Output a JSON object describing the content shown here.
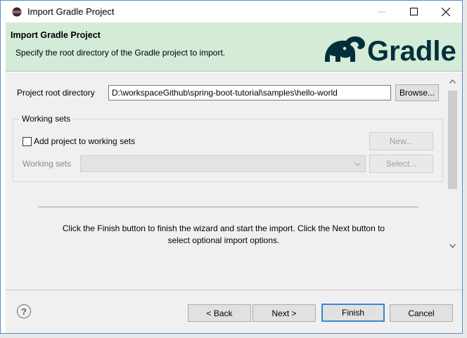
{
  "window": {
    "title": "Import Gradle Project",
    "minimize_icon": "minimize-icon",
    "maximize_icon": "maximize-icon",
    "close_icon": "close-icon"
  },
  "banner": {
    "title": "Import Gradle Project",
    "description": "Specify the root directory of the Gradle project to import.",
    "logo_text": "Gradle",
    "logo_color": "#02303a",
    "background_color": "#d4ebd8"
  },
  "form": {
    "root_label": "Project root directory",
    "root_value": "D:\\workspaceGithub\\spring-boot-tutorial\\samples\\hello-world",
    "browse_label": "Browse...",
    "working_sets_group": "Working sets",
    "add_checkbox_label": "Add project to working sets",
    "add_checkbox_checked": false,
    "new_label": "New...",
    "working_sets_label": "Working sets",
    "select_label": "Select..."
  },
  "message": "Click the Finish button to finish the wizard and start the import. Click the Next button to select optional import options.",
  "footer": {
    "help_icon": "help-icon",
    "help_glyph": "?",
    "back_label": "< Back",
    "next_label": "Next >",
    "finish_label": "Finish",
    "cancel_label": "Cancel"
  }
}
